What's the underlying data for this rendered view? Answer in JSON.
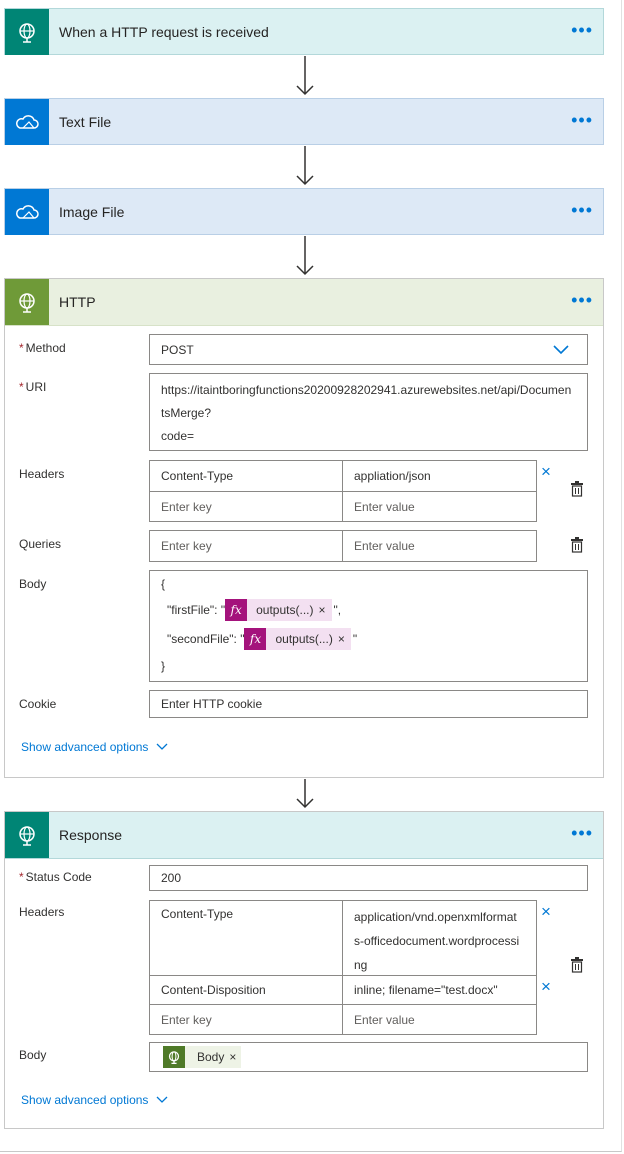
{
  "trigger": {
    "title": "When a HTTP request is received",
    "menu": "•••",
    "color": "#008575"
  },
  "text_file": {
    "title": "Text File",
    "menu": "•••",
    "color": "#0078d4"
  },
  "image_file": {
    "title": "Image File",
    "menu": "•••",
    "color": "#0078d4"
  },
  "http": {
    "title": "HTTP",
    "menu": "•••",
    "color": "#6f9a38",
    "method": {
      "label": "Method",
      "value": "POST"
    },
    "uri": {
      "label": "URI",
      "lines": [
        "https://itaintboringfunctions20200928202941.azurewebsites.net/api/Documen",
        "tsMerge?",
        "code="
      ]
    },
    "headers": {
      "label": "Headers",
      "rows": [
        {
          "key": "Content-Type",
          "value": "appliation/json"
        }
      ],
      "key_placeholder": "Enter key",
      "value_placeholder": "Enter value"
    },
    "queries": {
      "label": "Queries",
      "key_placeholder": "Enter key",
      "value_placeholder": "Enter value"
    },
    "body": {
      "label": "Body",
      "open": "{",
      "close": "}",
      "first_key": "\"firstFile\": \"",
      "first_token": "outputs(...)",
      "first_suffix": "\",",
      "second_key": "\"secondFile\": \"",
      "second_token": "outputs(...)",
      "second_suffix": "\"",
      "fx": "fx",
      "remove": "×"
    },
    "cookie": {
      "label": "Cookie",
      "placeholder": "Enter HTTP cookie"
    },
    "advanced": "Show advanced options"
  },
  "response": {
    "title": "Response",
    "menu": "•••",
    "color": "#008575",
    "status_code": {
      "label": "Status Code",
      "value": "200"
    },
    "headers": {
      "label": "Headers",
      "row1": {
        "key": "Content-Type",
        "value_lines": [
          "application/vnd.openxmlformat",
          "s-officedocument.wordprocessi",
          "ng"
        ]
      },
      "row2": {
        "key": "Content-Disposition",
        "value": "inline; filename=\"test.docx\""
      },
      "key_placeholder": "Enter key",
      "value_placeholder": "Enter value"
    },
    "body": {
      "label": "Body",
      "token": "Body",
      "remove": "×"
    },
    "advanced": "Show advanced options"
  },
  "required_mark": "*",
  "remove_icon": "×"
}
